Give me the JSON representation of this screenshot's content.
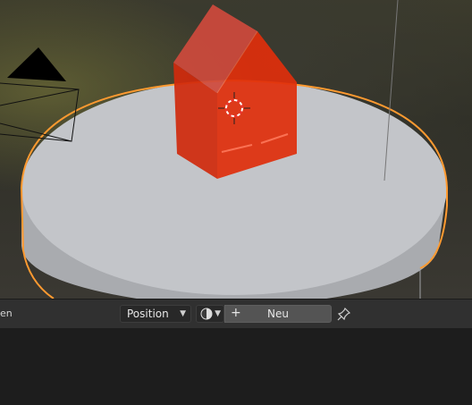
{
  "panel": {
    "left_label": "en",
    "mapping_select": {
      "value": "Position"
    },
    "color_select_icon": "shading-sphere-icon",
    "new_button": {
      "label": "Neu",
      "icon": "plus-icon"
    },
    "pin_icon": "pin-icon"
  },
  "colors": {
    "house": "#d92c10",
    "cylinder_top": "#c4c6ca",
    "selection_outline": "#ff9a30",
    "header_bg": "#303030",
    "panel_bg": "#1d1d1d",
    "new_button_bg": "#545454"
  }
}
